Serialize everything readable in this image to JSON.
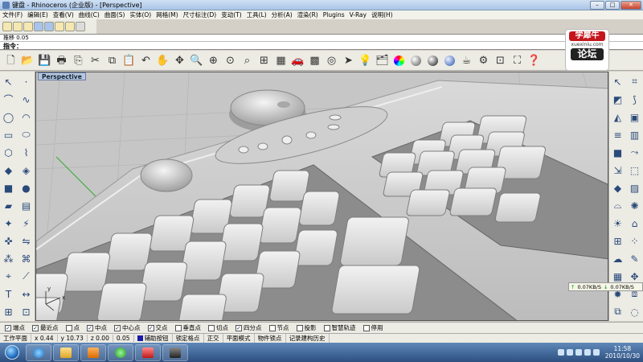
{
  "window": {
    "title": "键盘 - Rhinoceros (企业版) - [Perspective]",
    "minimize": "–",
    "maximize": "□",
    "close": "✕"
  },
  "menu": [
    "文件(F)",
    "编辑(E)",
    "查看(V)",
    "曲线(C)",
    "曲面(S)",
    "实体(O)",
    "网格(M)",
    "尺寸标注(D)",
    "变动(T)",
    "工具(L)",
    "分析(A)",
    "渲染(R)",
    "Plugins",
    "V-Ray",
    "说明(H)"
  ],
  "command": {
    "history": "推移 0.05",
    "prompt": "指令："
  },
  "logo": {
    "line1": "学犀牛",
    "line2": "xuexiniu.com",
    "line3": "论坛"
  },
  "viewport": {
    "name": "Perspective",
    "axis_x": "x",
    "axis_y": "y"
  },
  "osnaps": [
    {
      "label": "端点",
      "checked": true
    },
    {
      "label": "最近点",
      "checked": true
    },
    {
      "label": "点",
      "checked": false
    },
    {
      "label": "中点",
      "checked": true
    },
    {
      "label": "中心点",
      "checked": true
    },
    {
      "label": "交点",
      "checked": true
    },
    {
      "label": "垂直点",
      "checked": false
    },
    {
      "label": "切点",
      "checked": false
    },
    {
      "label": "四分点",
      "checked": true
    },
    {
      "label": "节点",
      "checked": false
    },
    {
      "label": "投影",
      "checked": false
    },
    {
      "label": "智慧轨迹",
      "checked": false
    },
    {
      "label": "停用",
      "checked": false
    }
  ],
  "status": {
    "cplane": "工作平面",
    "x": "x 0.44",
    "y": "y 10.73",
    "z": "z 0.00",
    "value": "0.05",
    "layer": "辅助按钮",
    "lock_grid": "锁定格点",
    "ortho": "正交",
    "planar": "平面模式",
    "object_snap": "物件锁点",
    "record_history": "记录建构历史",
    "layer_color": "#1a1aa8"
  },
  "speed": {
    "up": "0.07KB/S",
    "down": "0.07KB/S"
  },
  "clock": {
    "time": "11:58",
    "date": "2010/10/30"
  }
}
